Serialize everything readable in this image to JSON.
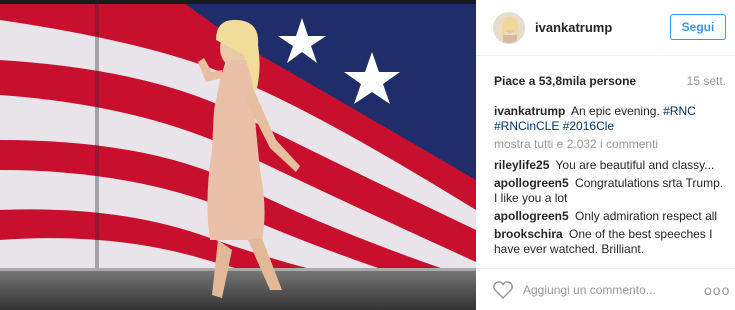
{
  "post": {
    "username": "ivankatrump",
    "follow_label": "Segui",
    "likes": "Piace a 53,8mila persone",
    "date": "15 sett.",
    "caption": {
      "author": "ivankatrump",
      "text": "An epic evening.",
      "hashtags": [
        "#RNC",
        "#RNCinCLE",
        "#2016Cle"
      ]
    },
    "show_all_comments": "mostra tutti e 2.032 i commenti",
    "comments": [
      {
        "author": "rileylife25",
        "text": "You are beautiful and classy..."
      },
      {
        "author": "apollogreen5",
        "text": "Congratulations srta Trump. I like you a lot"
      },
      {
        "author": "apollogreen5",
        "text": "Only admiration respect all"
      },
      {
        "author": "brookschira",
        "text": "One of the best speeches I have ever watched. Brilliant."
      }
    ],
    "add_comment_placeholder": "Aggiungi un commento...",
    "more_label": "ooo"
  },
  "icons": {
    "like": "heart-icon",
    "options": "more-options-icon"
  },
  "colors": {
    "accent": "#3897f0",
    "hashtag": "#003569",
    "muted": "#999999"
  }
}
